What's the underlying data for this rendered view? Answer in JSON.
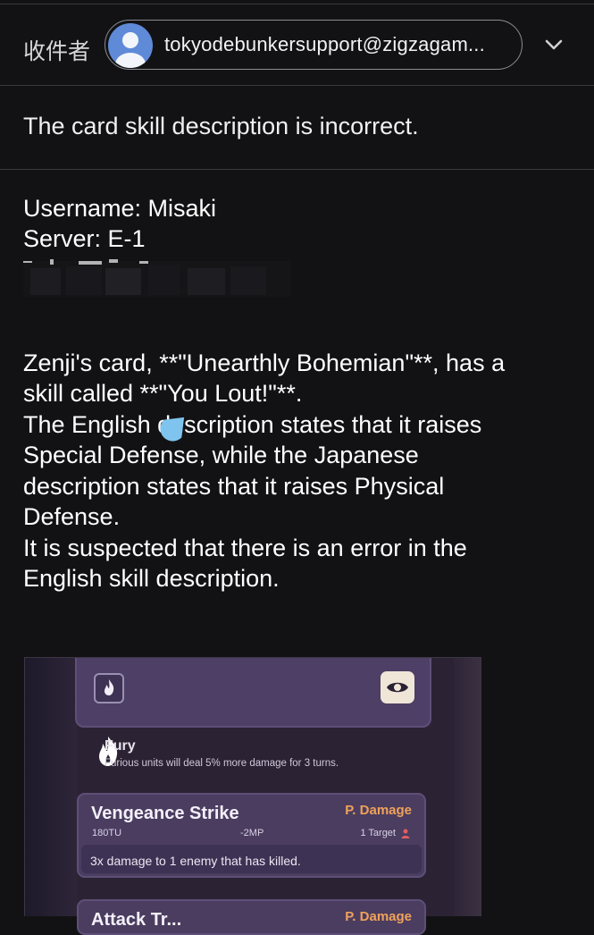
{
  "header": {
    "to_label": "收件者",
    "sender_email": "tokyodebunkersupport@zigzagam..."
  },
  "subject": "The card skill description is incorrect.",
  "body": {
    "line1": "Username: Misaki",
    "line2": "Server: E-1",
    "para": [
      "Zenji's card, **\"Unearthly Bohemian\"**, has a",
      "skill called **\"You Lout!\"**.",
      "The English description states that it raises",
      "Special Defense, while the Japanese",
      "description states that it raises Physical",
      "Defense.",
      "It is suspected that there is an error in the",
      "English skill description."
    ]
  },
  "attachment": {
    "status": {
      "name": "Fury",
      "description": "Furious units will deal 5% more damage for 3 turns."
    },
    "skills": [
      {
        "name": "Vengeance Strike",
        "type": "P. Damage",
        "tu": "180TU",
        "mp": "-2MP",
        "target": "1 Target",
        "description": "3x damage to 1 enemy that has killed."
      },
      {
        "name": "Attack Tr...",
        "type": "P. Damage"
      }
    ]
  },
  "colors": {
    "background": "#121214",
    "chip_border": "#8a8c92",
    "avatar": "#5f8ad8",
    "damage_type": "#f0a15a",
    "card_purple": "#4a3d60"
  }
}
